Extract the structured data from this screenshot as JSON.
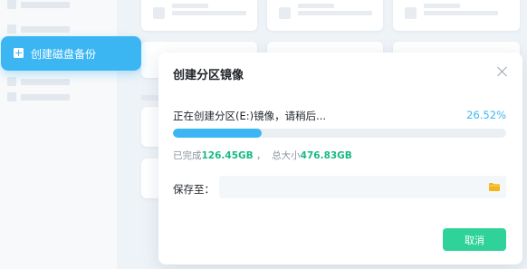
{
  "sidebar": {
    "active_item": {
      "label": "创建磁盘备份",
      "icon": "add-square-icon"
    }
  },
  "dialog": {
    "title": "创建分区镜像",
    "close_icon": "close-icon",
    "status_text": "正在创建分区(E:)镜像，请稍后...",
    "progress_percent_text": "26.52%",
    "progress_value": 0.2652,
    "size_info": {
      "completed_label": "已完成",
      "completed_value": "126.45GB",
      "separator": " ，  ",
      "total_label": "总大小",
      "total_value": "476.83GB"
    },
    "save_label": "保存至：",
    "save_path_value": "",
    "folder_icon": "folder-icon",
    "cancel_button": "取消"
  },
  "colors": {
    "accent_blue": "#3cb6f3",
    "accent_green": "#2fd39a",
    "size_green": "#19b985",
    "folder_yellow": "#f5b417"
  }
}
